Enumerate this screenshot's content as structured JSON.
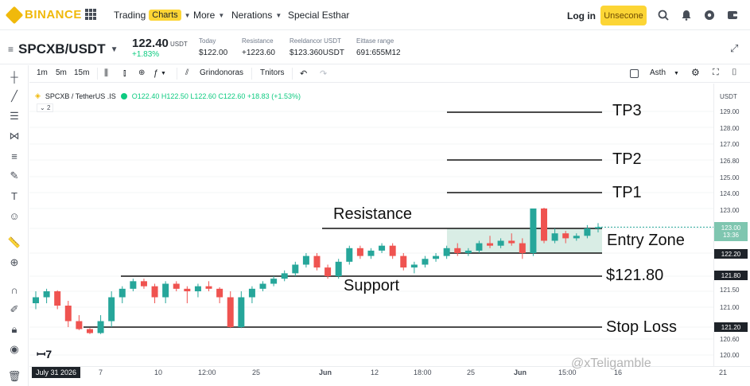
{
  "brand": {
    "name": "BINANCE",
    "color": "#f0b90b"
  },
  "topnav": {
    "trading": "Trading",
    "charts_badge": "Charts",
    "more": "More",
    "nerations": "Nerations",
    "special": "Special Esthar",
    "login": "Log in",
    "signup": "Unsecone"
  },
  "pair": {
    "symbol": "SPCXB/USDT",
    "price": "122.40",
    "price_unit": "USDT",
    "change": "+1.83%",
    "stats": [
      {
        "label": "Today",
        "value": "$122.00",
        "green": false
      },
      {
        "label": "Resistance",
        "value": "+1223.60",
        "green": false
      },
      {
        "label": "Reeldancor USDT",
        "value": "$123.360USDT",
        "green": false
      },
      {
        "label": "Eittase range",
        "value": "691:655M12",
        "green": false
      }
    ]
  },
  "toolbar": {
    "intervals": [
      "1m",
      "5m",
      "15m"
    ],
    "indicators": "Grindonoras",
    "tenitor": "Tnitors",
    "auto": "Asth"
  },
  "legend": {
    "symbol": "SPCXB / TetherUS .IS",
    "ohlc": "O122.40  H122.50  L122.60  C122.60  +18.83 (+1.53%)",
    "count": "2"
  },
  "yaxis": {
    "unit": "USDT",
    "ticks": [
      "129.00",
      "128.00",
      "127.00",
      "126.80",
      "125.00",
      "124.00",
      "123.00",
      "121.80",
      "121.50",
      "121.00",
      "120.60",
      "120.00"
    ],
    "badges": [
      {
        "text": "123.00",
        "sub": "13:36",
        "color": "#7fc6b0"
      },
      {
        "text": "122.20",
        "color": "#1e2329"
      },
      {
        "text": "121.80",
        "color": "#1e2329"
      },
      {
        "text": "121.20",
        "color": "#1e2329"
      }
    ]
  },
  "xaxis": {
    "date_chip": "July 31 2026",
    "ticks": [
      "7",
      "10",
      "12:00",
      "25",
      "Jun",
      "12",
      "18:00",
      "25",
      "Jun",
      "15:00",
      "16",
      "21"
    ]
  },
  "annotations": {
    "tp3": "TP3",
    "tp2": "TP2",
    "tp1": "TP1",
    "resistance": "Resistance",
    "entry_zone": "Entry Zone",
    "price_level": "$121.80",
    "support": "Support",
    "stop_loss": "Stop Loss"
  },
  "watermark": "@xTeligamble",
  "colors": {
    "up": "#26a69a",
    "down": "#ef5350",
    "zone": "#cfe9df"
  },
  "chart_data": {
    "type": "candlestick",
    "candles": [
      [
        121.4,
        121.5,
        121.35,
        121.45
      ],
      [
        121.45,
        121.55,
        121.4,
        121.5
      ],
      [
        121.5,
        121.52,
        121.35,
        121.38
      ],
      [
        121.38,
        121.42,
        121.2,
        121.25
      ],
      [
        121.25,
        121.3,
        121.05,
        121.1
      ],
      [
        121.1,
        121.15,
        120.85,
        120.9
      ],
      [
        120.9,
        121.3,
        120.85,
        121.25
      ],
      [
        121.25,
        121.5,
        121.2,
        121.45
      ],
      [
        121.45,
        121.6,
        121.4,
        121.55
      ],
      [
        121.55,
        121.75,
        121.5,
        121.7
      ],
      [
        121.7,
        121.75,
        121.55,
        121.6
      ],
      [
        121.6,
        121.65,
        121.4,
        121.45
      ],
      [
        121.45,
        121.7,
        121.4,
        121.65
      ],
      [
        121.65,
        121.7,
        121.5,
        121.55
      ],
      [
        121.55,
        121.6,
        121.4,
        121.5
      ],
      [
        121.5,
        121.65,
        121.45,
        121.6
      ],
      [
        121.6,
        121.7,
        121.5,
        121.55
      ],
      [
        121.55,
        121.58,
        121.4,
        121.45
      ],
      [
        121.45,
        121.5,
        121.15,
        121.2
      ],
      [
        121.2,
        121.5,
        121.15,
        121.45
      ],
      [
        121.45,
        121.6,
        121.4,
        121.55
      ],
      [
        121.55,
        121.7,
        121.5,
        121.65
      ],
      [
        121.65,
        121.8,
        121.6,
        121.75
      ],
      [
        121.75,
        121.9,
        121.7,
        121.85
      ],
      [
        121.85,
        122.05,
        121.8,
        122.0
      ],
      [
        122.0,
        122.2,
        121.95,
        122.15
      ],
      [
        122.15,
        122.2,
        121.9,
        121.95
      ],
      [
        121.95,
        122.0,
        121.75,
        121.8
      ],
      [
        121.8,
        122.1,
        121.75,
        122.05
      ],
      [
        122.05,
        122.35,
        122.0,
        122.3
      ],
      [
        122.3,
        122.35,
        122.1,
        122.15
      ],
      [
        122.15,
        122.3,
        122.1,
        122.25
      ],
      [
        122.25,
        122.4,
        122.2,
        122.35
      ],
      [
        122.35,
        122.4,
        122.1,
        122.15
      ],
      [
        122.15,
        122.2,
        121.9,
        121.95
      ],
      [
        121.95,
        122.05,
        121.85,
        122.0
      ],
      [
        122.0,
        122.15,
        121.95,
        122.1
      ],
      [
        122.1,
        122.2,
        122.05,
        122.15
      ],
      [
        122.15,
        122.35,
        122.1,
        122.3
      ],
      [
        122.3,
        122.4,
        122.15,
        122.2
      ],
      [
        122.2,
        122.3,
        122.15,
        122.25
      ],
      [
        122.25,
        122.45,
        122.2,
        122.4
      ],
      [
        122.4,
        122.55,
        122.3,
        122.35
      ],
      [
        122.35,
        122.5,
        122.3,
        122.45
      ],
      [
        122.45,
        122.6,
        122.35,
        122.4
      ],
      [
        122.4,
        122.5,
        122.1,
        122.2
      ],
      [
        122.2,
        122.6,
        122.15,
        123.0
      ],
      [
        123.0,
        123.05,
        122.4,
        122.45
      ],
      [
        122.45,
        122.7,
        122.4,
        122.6
      ],
      [
        122.6,
        122.65,
        122.4,
        122.5
      ],
      [
        122.5,
        122.6,
        122.45,
        122.55
      ],
      [
        122.55,
        122.75,
        122.5,
        122.7
      ],
      [
        122.7,
        122.78,
        122.62,
        122.72
      ]
    ],
    "levels": {
      "tp3": 128.0,
      "tp2": 126.8,
      "tp1": 124.0,
      "resistance": 122.7,
      "entry_top": 122.7,
      "entry_bottom": 122.2,
      "support": 121.8,
      "stop_loss": 121.2
    }
  }
}
